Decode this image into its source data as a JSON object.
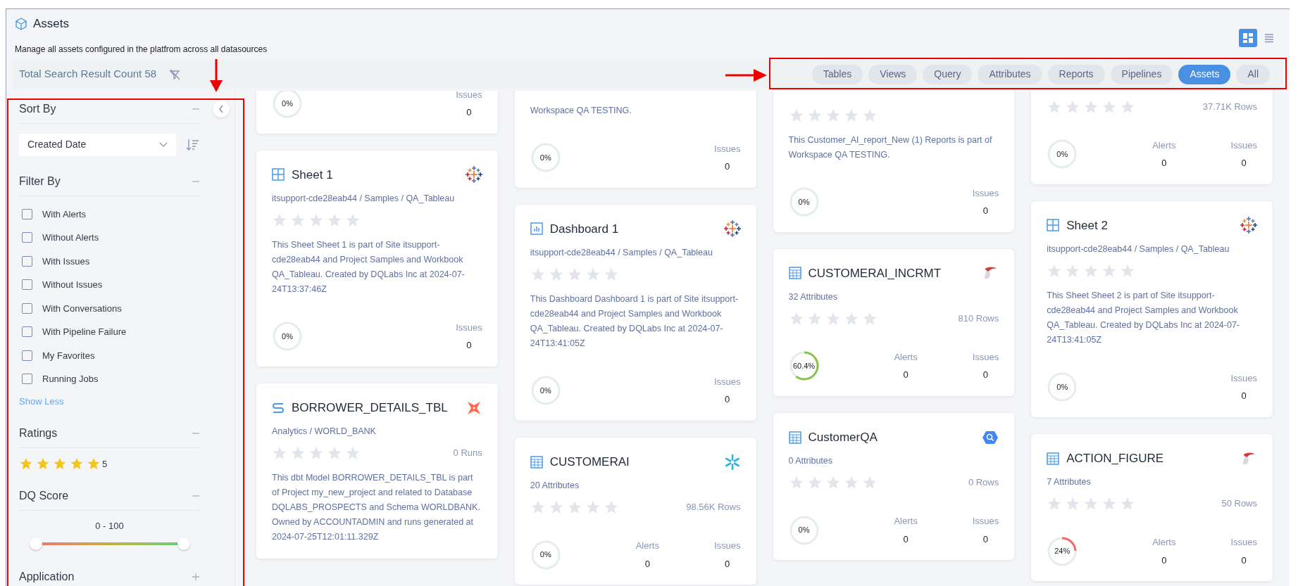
{
  "header": {
    "title": "Assets",
    "subtitle": "Manage all assets configured in the platfrom across all datasources",
    "views": [
      {
        "kind": "grid",
        "selected": true
      },
      {
        "kind": "list",
        "selected": false
      }
    ]
  },
  "search": {
    "count": "Total Search Result Count 58"
  },
  "tabs": [
    {
      "label": "Tables",
      "selected": false
    },
    {
      "label": "Views",
      "selected": false
    },
    {
      "label": "Query",
      "selected": false
    },
    {
      "label": "Attributes",
      "selected": false
    },
    {
      "label": "Reports",
      "selected": false
    },
    {
      "label": "Pipelines",
      "selected": false
    },
    {
      "label": "Assets",
      "selected": true
    },
    {
      "label": "All",
      "selected": false
    }
  ],
  "sidebar": {
    "sort": {
      "title": "Sort By",
      "expanded": true,
      "value": "Created Date"
    },
    "filter": {
      "title": "Filter By",
      "expanded": true,
      "options": [
        {
          "label": "With Alerts",
          "checked": false
        },
        {
          "label": "Without Alerts",
          "checked": false
        },
        {
          "label": "With Issues",
          "checked": false
        },
        {
          "label": "Without Issues",
          "checked": false
        },
        {
          "label": "With Conversations",
          "checked": false
        },
        {
          "label": "With Pipeline Failure",
          "checked": false
        },
        {
          "label": "My Favorites",
          "checked": false
        },
        {
          "label": "Running Jobs",
          "checked": false
        }
      ],
      "toggle": "Show Less"
    },
    "ratings": {
      "title": "Ratings",
      "expanded": true,
      "stars": 5,
      "label": "5"
    },
    "dq_score": {
      "title": "DQ Score",
      "expanded": true,
      "range": "0 - 100",
      "level": 1
    },
    "application": {
      "title": "Application",
      "expanded": false
    }
  },
  "columns": [
    {
      "cards": [
        {
          "score": "0%",
          "stats": [
            {
              "label": "Issues",
              "value": "0"
            }
          ]
        },
        {
          "kind": "sheet",
          "logo": {
            "kind": "tableau"
          },
          "title": "Sheet 1",
          "subtitle": "itsupport-cde28eab44 / Samples / QA_Tableau",
          "stars": 0,
          "description": "This Sheet Sheet 1 is part of Site itsupport-cde28eab44 and Project Samples and Workbook QA_Tableau. Created by DQLabs Inc at 2024-07-24T13:37:46Z",
          "score": "0%",
          "stats": [
            {
              "label": "Issues",
              "value": "0"
            }
          ]
        },
        {
          "kind": "dbt_model",
          "logo": {
            "kind": "dbt"
          },
          "title": "BORROWER_DETAILS_TBL",
          "subtitle": "Analytics / WORLD_BANK",
          "stars": 0,
          "metric": "0 Runs",
          "description": "This dbt Model BORROWER_DETAILS_TBL is part of Project my_new_project and related to Database DQLABS_PROSPECTS and Schema WORLDBANK. Owned by ACCOUNTADMIN and runs generated at 2024-07-25T12:01:11.329Z"
        }
      ]
    },
    {
      "cards": [
        {
          "description": "Workspace QA TESTING.",
          "score": "0%",
          "stats": [
            {
              "label": "Issues",
              "value": "0"
            }
          ]
        },
        {
          "kind": "dashboard",
          "logo": {
            "kind": "tableau"
          },
          "title": "Dashboard 1",
          "subtitle": "itsupport-cde28eab44 / Samples / QA_Tableau",
          "stars": 0,
          "description": "This Dashboard Dashboard 1 is part of Site itsupport-cde28eab44 and Project Samples and Workbook QA_Tableau. Created by DQLabs Inc at 2024-07-24T13:41:05Z",
          "score": "0%",
          "stats": [
            {
              "label": "Issues",
              "value": "0"
            }
          ]
        },
        {
          "kind": "table",
          "logo": {
            "kind": "snowflake"
          },
          "title": "CUSTOMERAI",
          "subtitle": "20 Attributes",
          "stars": 0,
          "metric": "98.56K Rows",
          "score": "0%",
          "stats": [
            {
              "label": "Alerts",
              "value": "0"
            },
            {
              "label": "Issues",
              "value": "0"
            }
          ]
        }
      ]
    },
    {
      "cards": [
        {
          "stars": 0,
          "description": "This Customer_AI_report_New (1) Reports is part of Workspace QA TESTING.",
          "score": "0%",
          "stats": [
            {
              "label": "Issues",
              "value": "0"
            }
          ]
        },
        {
          "kind": "table",
          "logo": {
            "kind": "sqlserver"
          },
          "title": "CUSTOMERAI_INCRMT",
          "subtitle": "32 Attributes",
          "stars": 0,
          "metric": "810 Rows",
          "score": "60.4%",
          "stats": [
            {
              "label": "Alerts",
              "value": "0"
            },
            {
              "label": "Issues",
              "value": "0"
            }
          ]
        },
        {
          "kind": "table",
          "logo": {
            "kind": "bigquery"
          },
          "title": "CustomerQA",
          "subtitle": "0 Attributes",
          "stars": 0,
          "metric": "0 Rows",
          "score": "0%",
          "stats": [
            {
              "label": "Alerts",
              "value": "0"
            },
            {
              "label": "Issues",
              "value": "0"
            }
          ]
        }
      ]
    },
    {
      "cards": [
        {
          "stars": 0,
          "metric": "37.71K Rows",
          "score": "0%",
          "stats": [
            {
              "label": "Alerts",
              "value": "0"
            },
            {
              "label": "Issues",
              "value": "0"
            }
          ]
        },
        {
          "kind": "sheet",
          "logo": {
            "kind": "tableau"
          },
          "title": "Sheet 2",
          "subtitle": "itsupport-cde28eab44 / Samples / QA_Tableau",
          "stars": 0,
          "description": "This Sheet Sheet 2 is part of Site itsupport-cde28eab44 and Project Samples and Workbook QA_Tableau. Created by DQLabs Inc at 2024-07-24T13:41:05Z",
          "score": "0%",
          "stats": [
            {
              "label": "Issues",
              "value": "0"
            }
          ]
        },
        {
          "kind": "table",
          "logo": {
            "kind": "sqlserver"
          },
          "title": "ACTION_FIGURE",
          "subtitle": "7 Attributes",
          "stars": 0,
          "metric": "50 Rows",
          "score": "24%",
          "stats": [
            {
              "label": "Alerts",
              "value": "0"
            },
            {
              "label": "Issues",
              "value": "0"
            }
          ]
        }
      ]
    }
  ]
}
